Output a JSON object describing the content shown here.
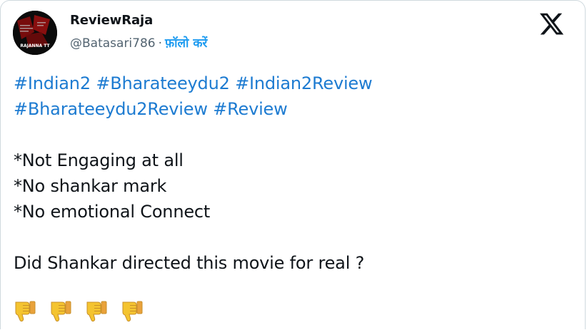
{
  "author": {
    "display_name": "ReviewRaja",
    "handle": "@Batasari786",
    "separator": "·",
    "follow_label": "फ़ॉलो करें",
    "avatar_text": "RAJANNA TT"
  },
  "platform": {
    "logo_icon": "x-logo-icon"
  },
  "tweet": {
    "hashtags_line1": [
      "#Indian2",
      "#Bharateeydu2",
      "#Indian2Review"
    ],
    "hashtags_line2": [
      "#Bharateeydu2Review",
      "#Review"
    ],
    "points": [
      "*Not Engaging at all",
      "*No shankar mark",
      "*No emotional Connect"
    ],
    "question": "Did Shankar directed this movie for real ?",
    "emoji_icon": "thumbs-down-icon",
    "emoji_count": 4
  },
  "colors": {
    "link": "#1d7bd1",
    "follow": "#1d9bf0",
    "text": "#0f1419",
    "secondary": "#536471",
    "emoji": "#f4c430"
  }
}
